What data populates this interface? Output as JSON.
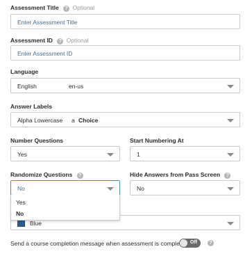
{
  "assessment_title": {
    "label": "Assessment Title",
    "optional": "Optional",
    "placeholder": "Enter Assessment Title"
  },
  "assessment_id": {
    "label": "Assessment ID",
    "optional": "Optional",
    "placeholder": "Enter Assessment ID"
  },
  "language": {
    "label": "Language",
    "value": "English",
    "code": "en-us"
  },
  "answer_labels": {
    "label": "Answer Labels",
    "value": "Alpha Lowercase",
    "example_letter": "a",
    "example_word": "Choice"
  },
  "number_questions": {
    "label": "Number Questions",
    "value": "Yes"
  },
  "start_numbering": {
    "label": "Start Numbering At",
    "value": "1"
  },
  "randomize_questions": {
    "label": "Randomize Questions",
    "value": "No",
    "options": [
      "Yes",
      "No"
    ]
  },
  "hide_answers": {
    "label": "Hide Answers from Pass Screen",
    "value": "No"
  },
  "color": {
    "value": "Blue",
    "swatch": "#2a5f94"
  },
  "completion_message": {
    "label": "Send a course completion message when assessment is completed",
    "toggle": "Off"
  },
  "help_glyph": "?"
}
